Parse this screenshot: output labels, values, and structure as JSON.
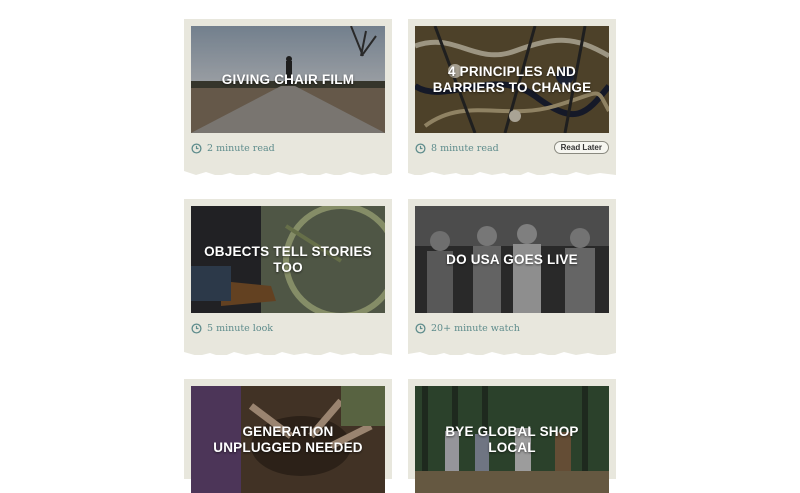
{
  "cards": [
    {
      "title": "GIVING CHAIR FILM",
      "meta": "2 minute read"
    },
    {
      "title": "4 PRINCIPLES AND BARRIERS TO CHANGE",
      "meta": "8 minute read",
      "action": "Read Later"
    },
    {
      "title": "OBJECTS TELL STORIES TOO",
      "meta": "5 minute look"
    },
    {
      "title": "DO USA GOES LIVE",
      "meta": "20+ minute watch"
    },
    {
      "title": "GENERATION UNPLUGGED NEEDED"
    },
    {
      "title": "BYE GLOBAL SHOP LOCAL"
    }
  ],
  "icons": {
    "meta": "clock-icon"
  },
  "colors": {
    "card_bg": "#e8e7dd",
    "meta_text": "#5e8c8c"
  }
}
